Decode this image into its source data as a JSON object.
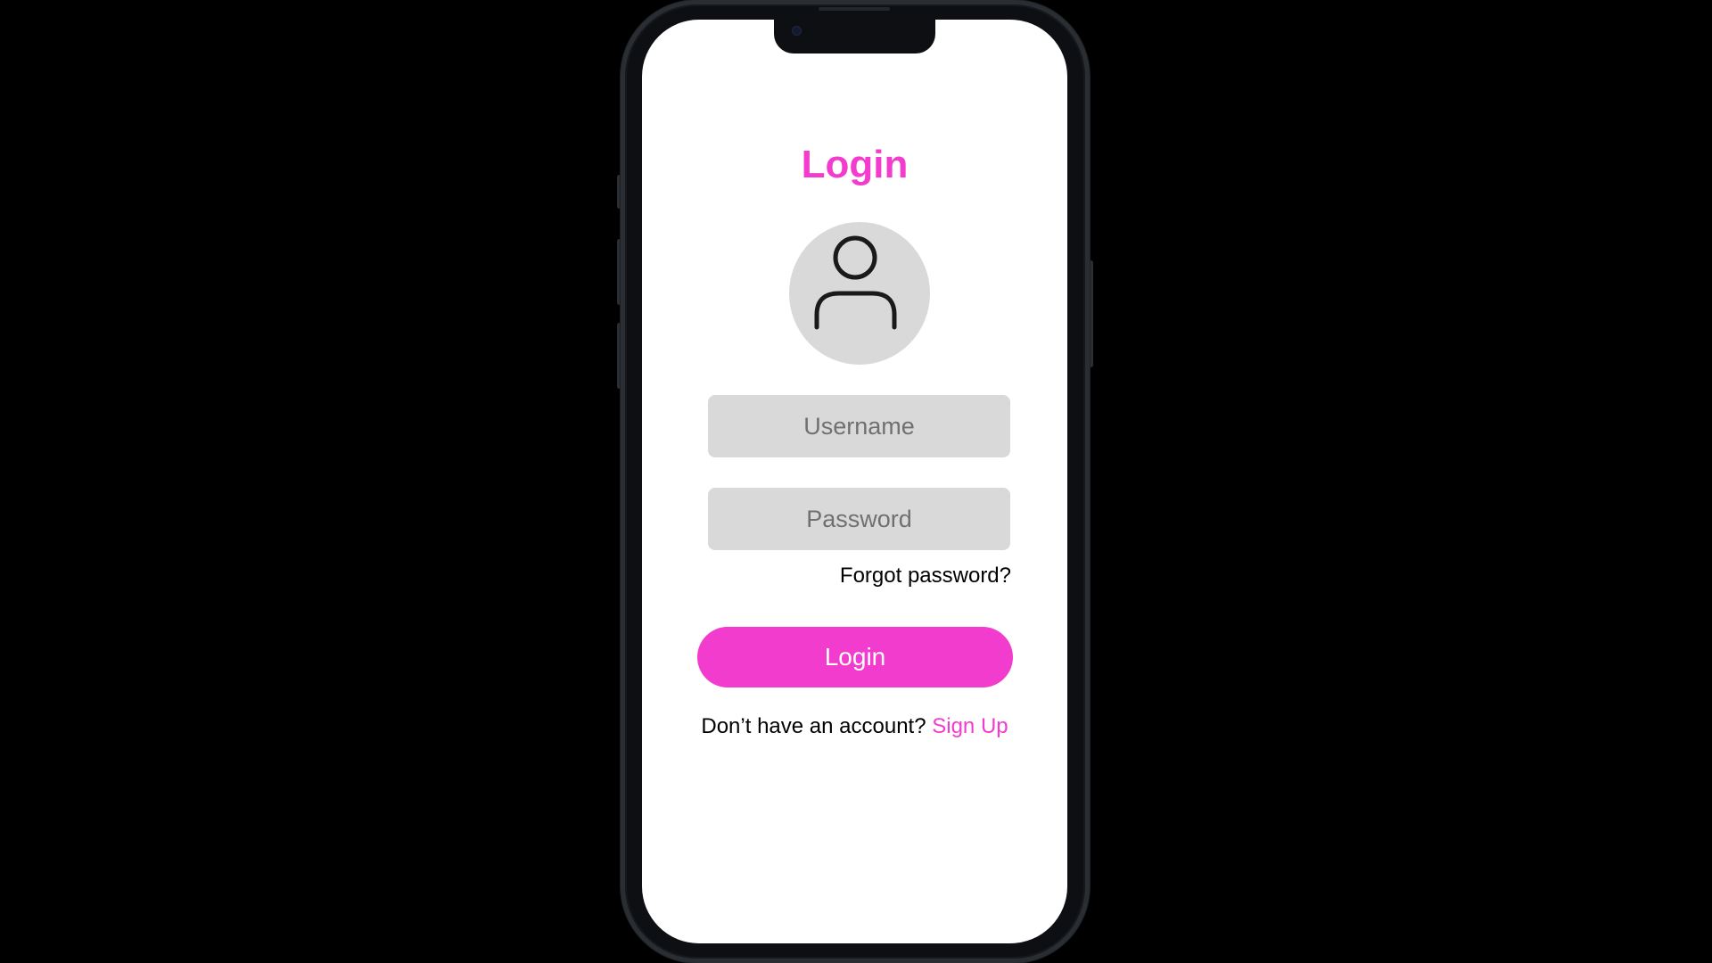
{
  "screen": {
    "title": "Login",
    "avatar_icon": "user-outline-icon",
    "username": {
      "placeholder": "Username",
      "value": ""
    },
    "password": {
      "placeholder": "Password",
      "value": ""
    },
    "forgot_password_label": "Forgot password?",
    "login_button_label": "Login",
    "signup_prompt": "Don’t have an account?",
    "signup_link_label": "Sign Up"
  },
  "colors": {
    "accent": "#f23ccd",
    "field_background": "#d9d9d9",
    "screen_background": "#ffffff",
    "page_background": "#000000"
  }
}
